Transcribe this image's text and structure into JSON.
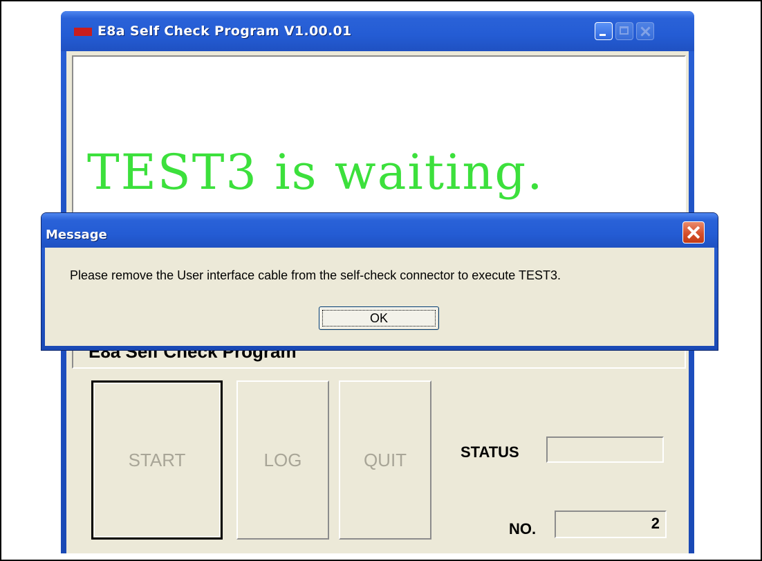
{
  "main_window": {
    "title": "E8a Self Check Program V1.00.01",
    "display_text": "TEST3 is waiting.",
    "program_strip": "E8a Self Check Program",
    "buttons": {
      "start": "START",
      "log": "LOG",
      "quit": "QUIT"
    },
    "status_label": "STATUS",
    "status_value": "",
    "no_label": "NO.",
    "no_value": "2",
    "display_text_color": "#3ce03c"
  },
  "dialog": {
    "title": "Message",
    "message": "Please remove the User interface cable from the self-check connector to execute TEST3.",
    "ok_label": "OK"
  }
}
